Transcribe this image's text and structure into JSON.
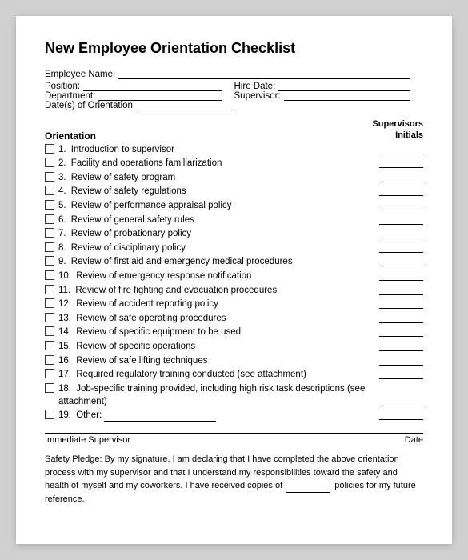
{
  "title": "New Employee Orientation Checklist",
  "fields": {
    "employee_name_label": "Employee Name:",
    "position_label": "Position:",
    "hire_date_label": "Hire Date:",
    "department_label": "Department:",
    "supervisor_label": "Supervisor:",
    "dates_label": "Date(s) of Orientation:"
  },
  "checklist_header": {
    "left": "Orientation",
    "right_line1": "Supervisors",
    "right_line2": "Initials"
  },
  "items": [
    {
      "num": "1.",
      "text": "Introduction to supervisor"
    },
    {
      "num": "2.",
      "text": "Facility and operations familiarization"
    },
    {
      "num": "3.",
      "text": "Review of safety program"
    },
    {
      "num": "4.",
      "text": "Review of safety regulations"
    },
    {
      "num": "5.",
      "text": "Review of performance appraisal policy"
    },
    {
      "num": "6.",
      "text": "Review of general safety rules"
    },
    {
      "num": "7.",
      "text": "Review of probationary policy"
    },
    {
      "num": "8.",
      "text": "Review of disciplinary policy"
    },
    {
      "num": "9.",
      "text": "Review of first aid and emergency medical procedures"
    },
    {
      "num": "10.",
      "text": "Review of emergency response notification"
    },
    {
      "num": "11.",
      "text": "Review of fire fighting and evacuation procedures"
    },
    {
      "num": "12.",
      "text": "Review of accident reporting policy"
    },
    {
      "num": "13.",
      "text": "Review of safe operating procedures"
    },
    {
      "num": "14.",
      "text": "Review of specific equipment to be used"
    },
    {
      "num": "15.",
      "text": "Review of specific operations"
    },
    {
      "num": "16.",
      "text": "Review of safe lifting techniques"
    },
    {
      "num": "17.",
      "text": "Required regulatory training conducted (see attachment)"
    },
    {
      "num": "18.",
      "text": "Job-specific training provided, including high risk task descriptions (see attachment)"
    },
    {
      "num": "19.",
      "text": "Other:"
    }
  ],
  "signature": {
    "supervisor_label": "Immediate Supervisor",
    "date_label": "Date"
  },
  "safety_pledge": {
    "text_before": "Safety Pledge: By my signature, I am declaring that I have completed the above orientation process with my supervisor and that I understand my responsibilities toward the safety and health of myself and my coworkers. I have received copies of",
    "text_after": "policies for my future reference."
  }
}
